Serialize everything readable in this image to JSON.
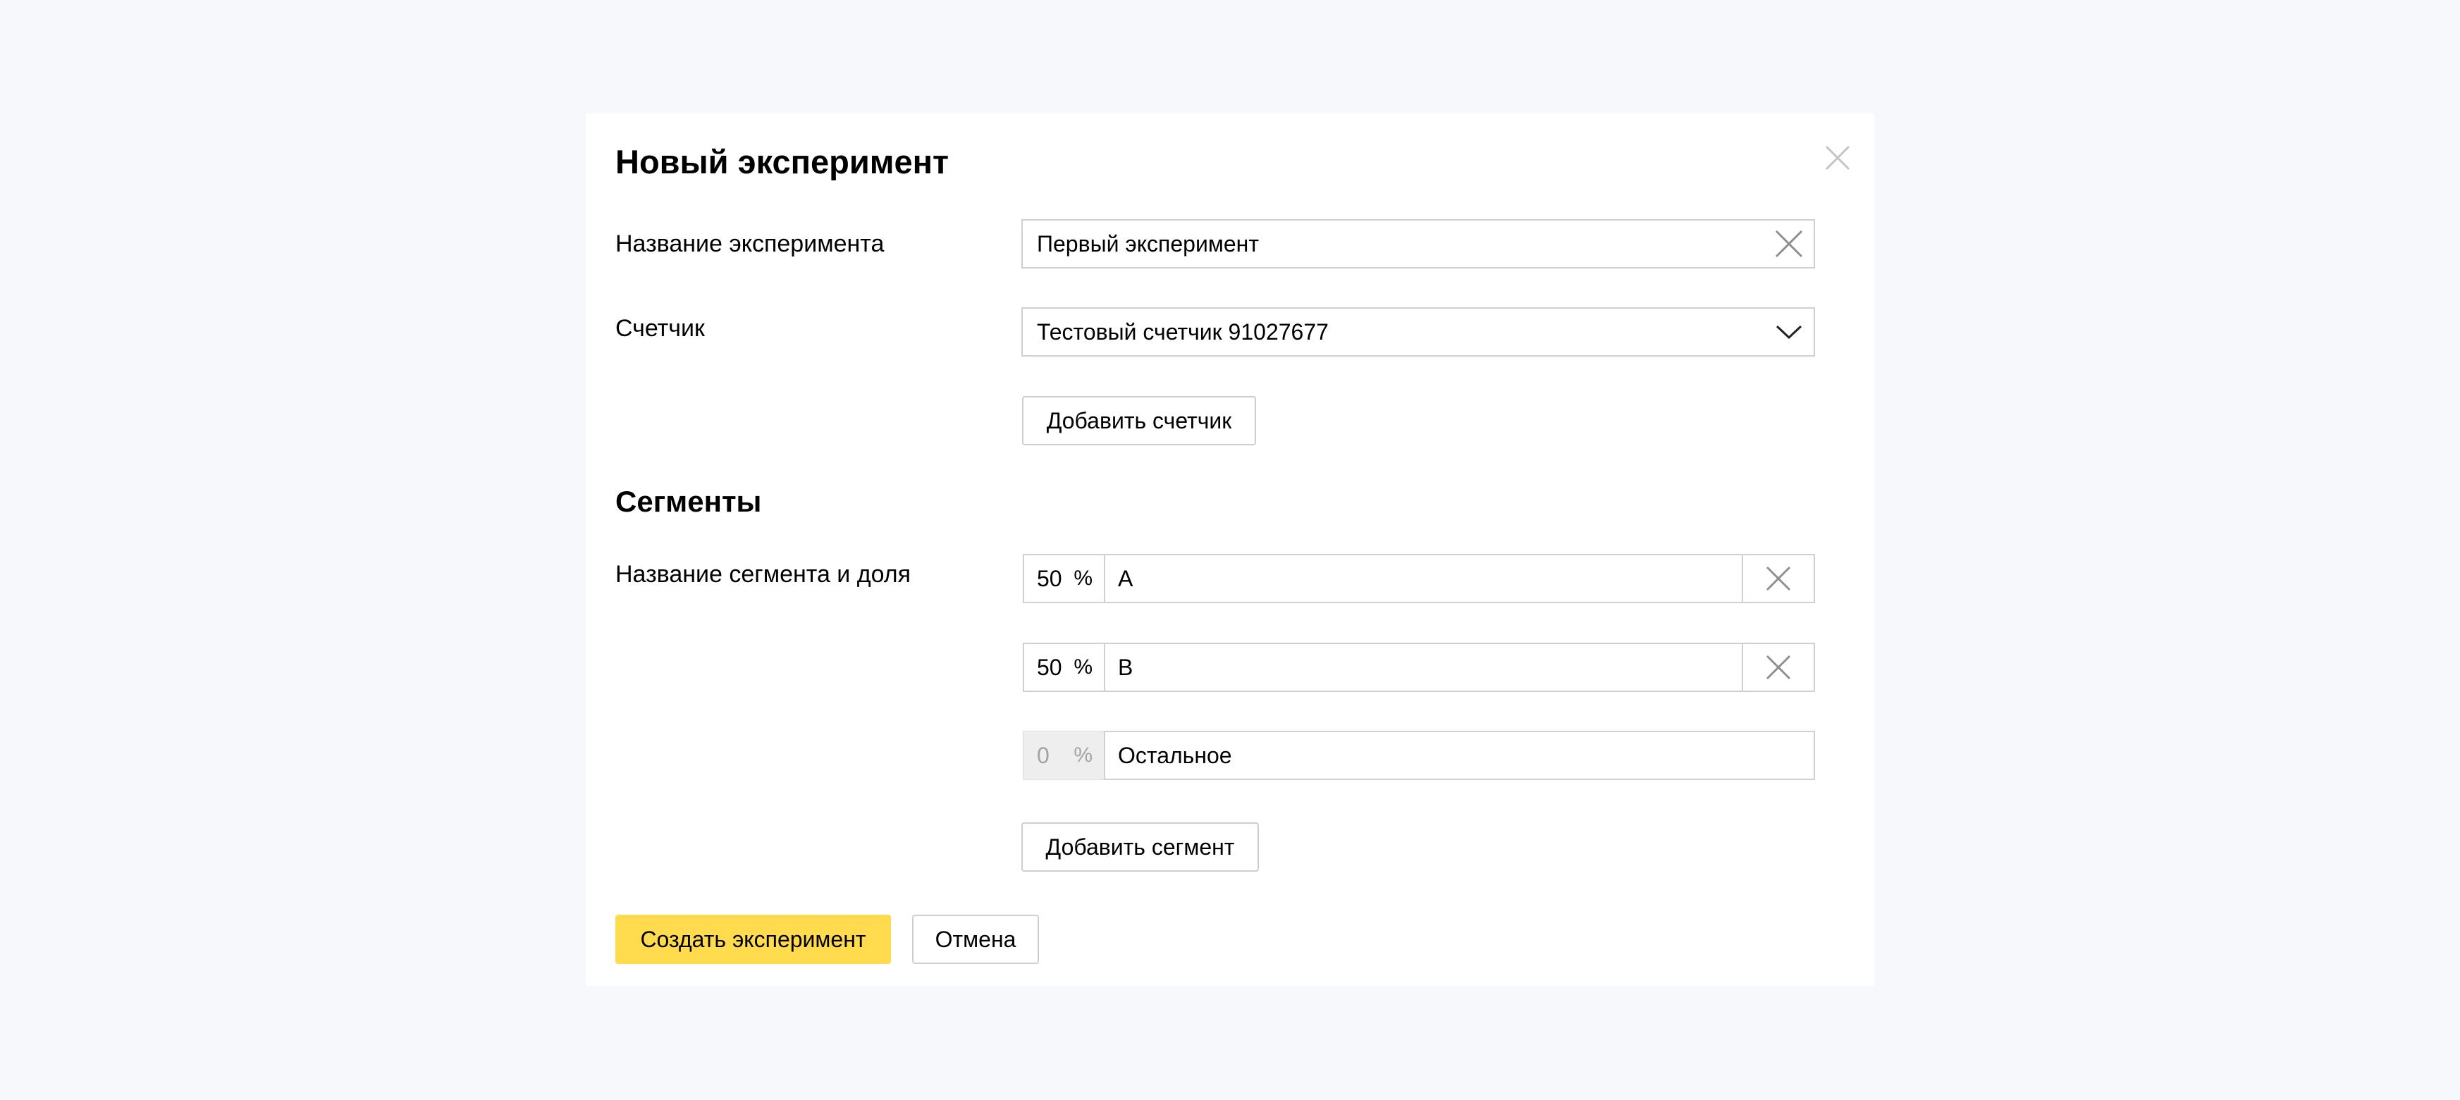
{
  "dialog": {
    "title": "Новый эксперимент",
    "close_icon": "close-icon"
  },
  "name_field": {
    "label": "Название эксперимента",
    "value": "Первый эксперимент"
  },
  "counter": {
    "label": "Счетчик",
    "selected": "Тестовый счетчик 91027677",
    "add_label": "Добавить счетчик"
  },
  "segments": {
    "title": "Сегменты",
    "label": "Название сегмента и доля",
    "percent_sign": "%",
    "items": [
      {
        "percent": "50",
        "name": "A",
        "removable": true
      },
      {
        "percent": "50",
        "name": "B",
        "removable": true
      },
      {
        "percent": "0",
        "name": "Остальное",
        "removable": false
      }
    ],
    "add_label": "Добавить сегмент"
  },
  "actions": {
    "create_label": "Создать эксперимент",
    "cancel_label": "Отмена"
  },
  "colors": {
    "background": "#f7f8fb",
    "primary_button": "#ffdb4d",
    "border": "#d0d0d0"
  }
}
